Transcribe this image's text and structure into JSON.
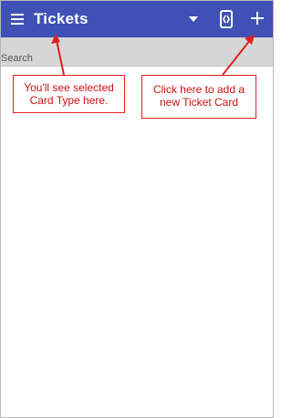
{
  "appbar": {
    "title": "Tickets",
    "icons": {
      "menu": "hamburger-menu-icon",
      "dropdown": "dropdown-arrow-icon",
      "swap": "card-type-switch-icon",
      "add": "plus-icon"
    },
    "color": "#3f51b5"
  },
  "search": {
    "label": "Search"
  },
  "annotations": [
    {
      "line1": "You'll see selected",
      "line2": "Card Type here."
    },
    {
      "line1": "Click here to add a",
      "line2": "new Ticket Card"
    }
  ],
  "annotation_color": "#e02020"
}
